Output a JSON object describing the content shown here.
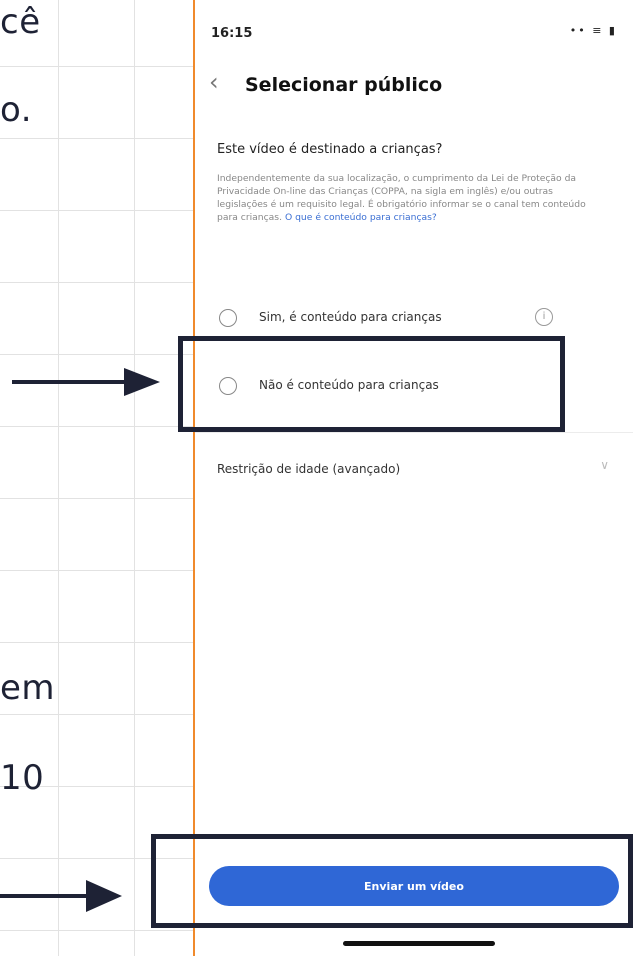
{
  "background_text": {
    "line1": "cê",
    "line2": "o.",
    "line3": "em",
    "line4": "10"
  },
  "phone": {
    "status_time": "16:15",
    "status_icons": "•• ≡ ▮",
    "header": {
      "back_icon": "chevron-left-icon",
      "title": "Selecionar público"
    },
    "question": "Este vídeo é destinado a crianças?",
    "description": "Independentemente da sua localização, o cumprimento da Lei de Proteção da Privacidade On-line das Crianças (COPPA, na sigla em inglês) e/ou outras legislações é um requisito legal. É obrigatório informar se o canal tem conteúdo para crianças.",
    "description_link": "O que é conteúdo para crianças?",
    "options": [
      {
        "label": "Sim, é conteúdo para crianças",
        "info_icon": "i"
      },
      {
        "label": "Não é conteúdo para crianças"
      }
    ],
    "age_restriction": {
      "label": "Restrição de idade (avançado)",
      "chevron": "∨"
    },
    "submit_button": "Enviar um vídeo"
  },
  "colors": {
    "accent_blue": "#2f67d6",
    "highlight_box": "#1e2235",
    "phone_border": "#f08a2c"
  }
}
